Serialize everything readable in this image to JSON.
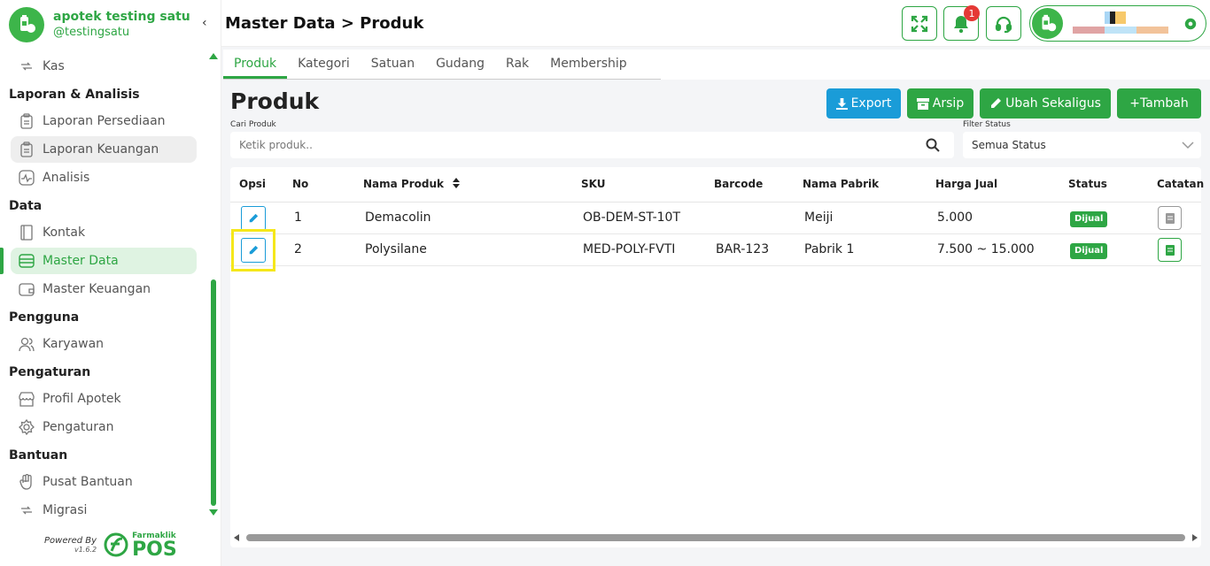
{
  "brand": {
    "name": "apotek testing satu",
    "handle": "@testingsatu"
  },
  "sidebar": {
    "sections": [
      {
        "title": "",
        "items": [
          {
            "label": "Kas",
            "icon": "money-transfer-icon"
          }
        ]
      },
      {
        "title": "Laporan & Analisis",
        "items": [
          {
            "label": "Laporan Persediaan",
            "icon": "clipboard-icon"
          },
          {
            "label": "Laporan Keuangan",
            "icon": "clipboard-icon"
          },
          {
            "label": "Analisis",
            "icon": "activity-icon"
          }
        ]
      },
      {
        "title": "Data",
        "items": [
          {
            "label": "Kontak",
            "icon": "contact-book-icon"
          },
          {
            "label": "Master Data",
            "icon": "database-icon"
          },
          {
            "label": "Master Keuangan",
            "icon": "wallet-icon"
          }
        ]
      },
      {
        "title": "Pengguna",
        "items": [
          {
            "label": "Karyawan",
            "icon": "users-icon"
          }
        ]
      },
      {
        "title": "Pengaturan",
        "items": [
          {
            "label": "Profil Apotek",
            "icon": "store-icon"
          },
          {
            "label": "Pengaturan",
            "icon": "gear-icon"
          }
        ]
      },
      {
        "title": "Bantuan",
        "items": [
          {
            "label": "Pusat Bantuan",
            "icon": "hand-icon"
          },
          {
            "label": "Migrasi",
            "icon": "migrate-icon"
          }
        ]
      }
    ],
    "powered_by": "Powered By",
    "version": "v1.6.2",
    "product_small": "Farmaklik",
    "product_big": "POS"
  },
  "header": {
    "breadcrumb": "Master Data > Produk",
    "notification_count": "1"
  },
  "tabs": [
    "Produk",
    "Kategori",
    "Satuan",
    "Gudang",
    "Rak",
    "Membership"
  ],
  "page": {
    "title": "Produk",
    "buttons": {
      "export": "Export",
      "arsip": "Arsip",
      "ubah": "Ubah Sekaligus",
      "tambah": "+Tambah"
    },
    "search": {
      "label": "Cari Produk",
      "placeholder": "Ketik produk.."
    },
    "filter": {
      "label": "Filter Status",
      "value": "Semua Status"
    }
  },
  "table": {
    "columns": [
      "Opsi",
      "No",
      "Nama Produk",
      "SKU",
      "Barcode",
      "Nama Pabrik",
      "Harga Jual",
      "Status",
      "Catatan"
    ],
    "rows": [
      {
        "no": "1",
        "nama": "Demacolin",
        "sku": "OB-DEM-ST-10T",
        "barcode": "",
        "pabrik": "Meiji",
        "harga": "5.000",
        "status": "Dijual"
      },
      {
        "no": "2",
        "nama": "Polysilane",
        "sku": "MED-POLY-FVTI",
        "barcode": "BAR-123",
        "pabrik": "Pabrik 1",
        "harga": "7.500 ~ 15.000",
        "status": "Dijual"
      }
    ]
  },
  "colors": {
    "primary_green": "#2ea644",
    "primary_blue": "#1a9cd8",
    "highlight": "#f5e71a",
    "badge_red": "#e53935"
  }
}
